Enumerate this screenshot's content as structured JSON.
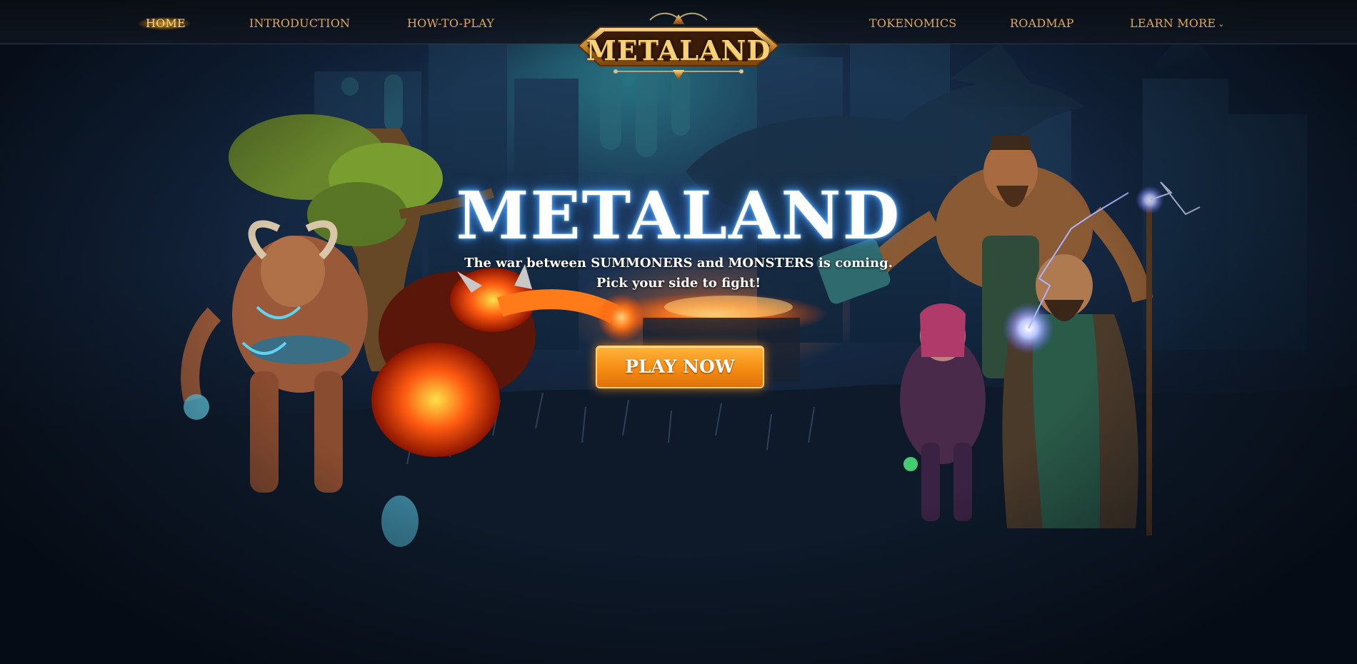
{
  "nav": {
    "left": [
      "HOME",
      "INTRODUCTION",
      "HOW-TO-PLAY"
    ],
    "right": [
      "TOKENOMICS",
      "ROADMAP",
      "LEARN MORE"
    ],
    "active": "HOME"
  },
  "logo": {
    "text": "METALAND"
  },
  "hero": {
    "title": "METALAND",
    "subtitle_line1": "The war between SUMMONERS and MONSTERS is coming.",
    "subtitle_line2": "Pick your side to fight!",
    "cta_label": "PLAY NOW"
  },
  "colors": {
    "nav_text": "#e0a85a",
    "accent_orange": "#f58c12",
    "title_glow": "#50aaff",
    "background": "#0b1322"
  },
  "icons": {
    "dropdown": "chevron-down-icon"
  }
}
